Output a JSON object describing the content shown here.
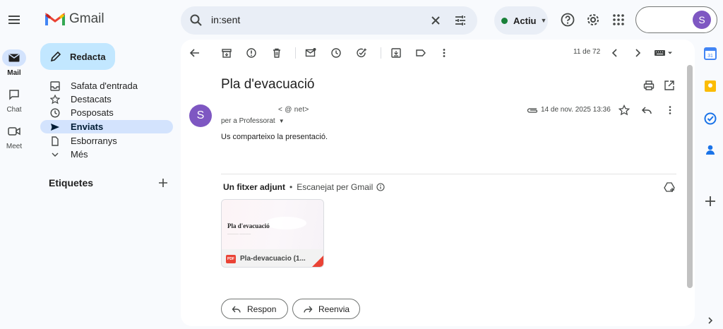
{
  "app": {
    "name": "Gmail"
  },
  "search": {
    "query": "in:sent"
  },
  "status": {
    "label": "Actiu",
    "color": "#188038"
  },
  "account": {
    "avatar_letter": "S",
    "avatar_color": "#7e57c2"
  },
  "rail": [
    {
      "label": "Mail",
      "icon": "mail-icon"
    },
    {
      "label": "Chat",
      "icon": "chat-icon"
    },
    {
      "label": "Meet",
      "icon": "meet-icon"
    }
  ],
  "compose": {
    "label": "Redacta"
  },
  "nav": [
    {
      "label": "Safata d'entrada",
      "icon": "inbox-icon"
    },
    {
      "label": "Destacats",
      "icon": "star-icon"
    },
    {
      "label": "Posposats",
      "icon": "clock-icon"
    },
    {
      "label": "Enviats",
      "icon": "send-icon",
      "active": true
    },
    {
      "label": "Esborranys",
      "icon": "draft-icon"
    },
    {
      "label": "Més",
      "icon": "chevron-down-icon"
    }
  ],
  "labels_section": {
    "title": "Etiquetes"
  },
  "toolbar": {
    "pager": "11 de 72"
  },
  "email": {
    "subject": "Pla d'evacuació",
    "sender_letter": "S",
    "sender_email": "<          @             net>",
    "to": "per a Professorat",
    "date": "14 de nov. 2025 13:36",
    "body": "Us comparteixo la presentació."
  },
  "attachments": {
    "header_count": "Un fitxer adjunt",
    "scan_note": "Escanejat per Gmail",
    "file": {
      "thumb_title": "Pla d'evacuació",
      "name": "Pla-devacuacio (1...",
      "type_badge": "PDF"
    }
  },
  "actions": {
    "reply": "Respon",
    "forward": "Reenvia"
  },
  "colors": {
    "accent": "#c2e7ff",
    "active_nav": "#d3e3fd",
    "pdf_red": "#ea4335"
  }
}
